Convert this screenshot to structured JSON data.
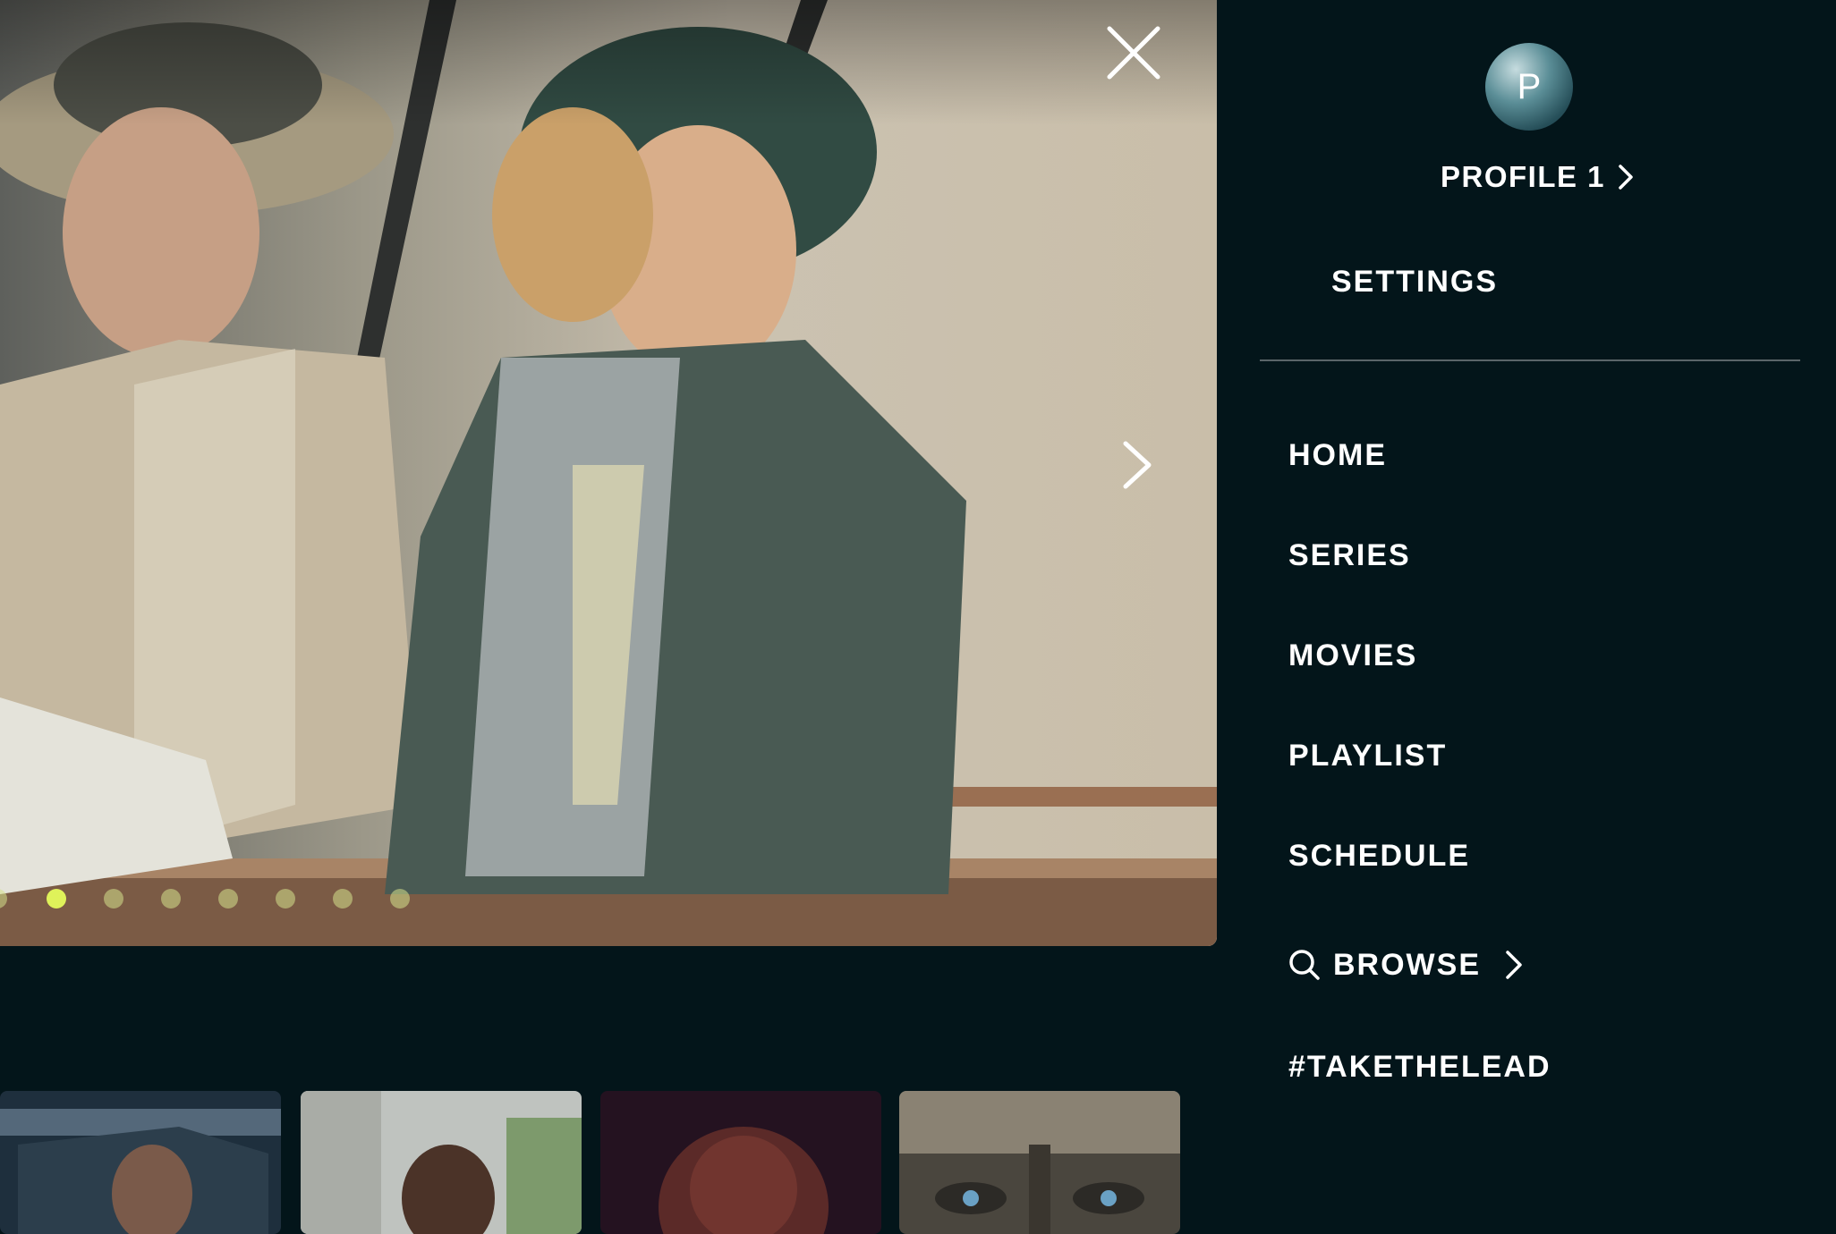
{
  "hero": {
    "slide_count": 8,
    "active_slide": 1
  },
  "thumbnails": [
    {
      "name": "thumb-car-scene",
      "icon": "image"
    },
    {
      "name": "thumb-cemetery-portrait",
      "icon": "image"
    },
    {
      "name": "thumb-dark-portrait",
      "icon": "image"
    },
    {
      "name": "thumb-warrior-helmet",
      "icon": "image"
    }
  ],
  "menu": {
    "avatar_initial": "P",
    "profile_name": "PROFILE 1",
    "settings_label": "SETTINGS",
    "nav": {
      "home": "HOME",
      "series": "SERIES",
      "movies": "MOVIES",
      "playlist": "PLAYLIST",
      "schedule": "SCHEDULE",
      "browse": "BROWSE",
      "take_the_lead": "#TAKETHELEAD"
    }
  },
  "colors": {
    "background": "#03151a",
    "accent_dot": "#dff25a",
    "divider": "#5a6569"
  }
}
